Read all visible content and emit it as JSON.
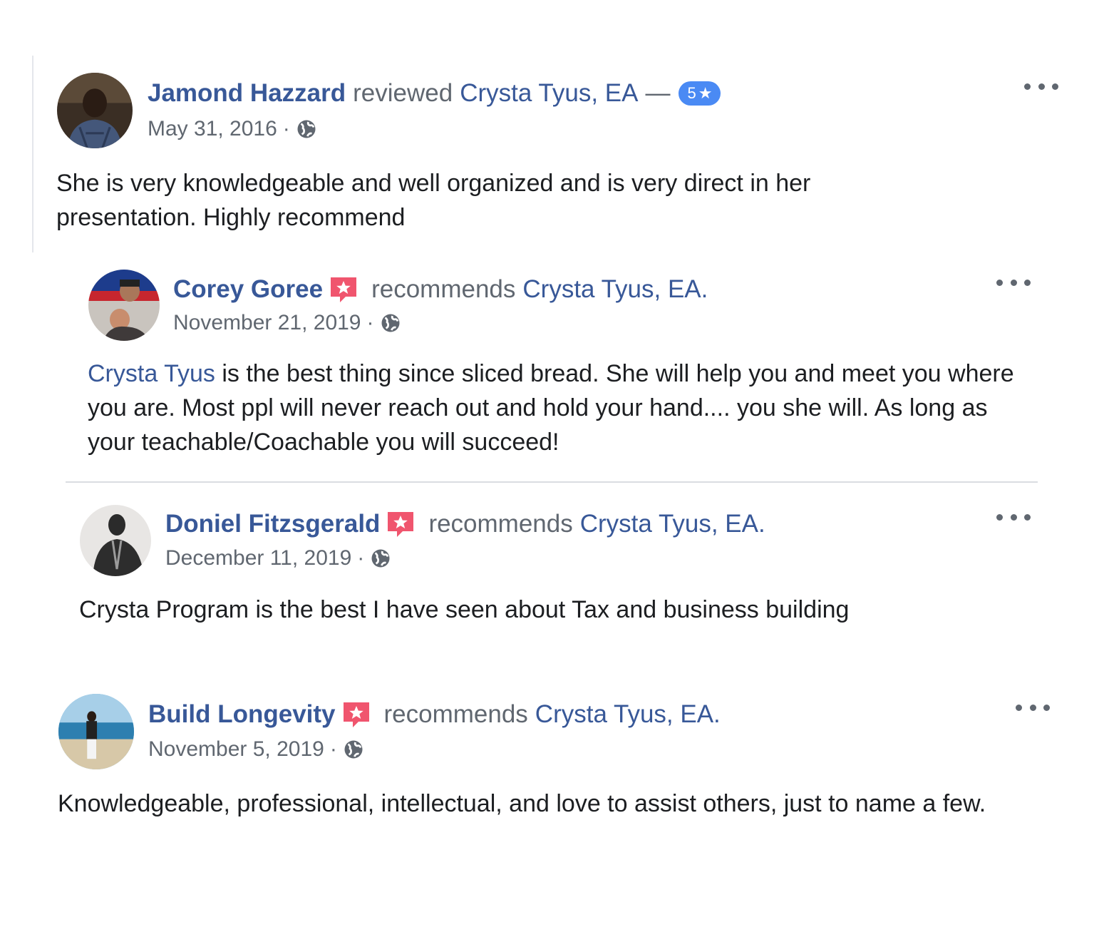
{
  "reviews": [
    {
      "name": "Jamond Hazzard",
      "verb": "reviewed",
      "page": "Crysta Tyus, EA",
      "dash": "—",
      "rating": "5",
      "rating_icon": "star-icon",
      "date": "May 31, 2016",
      "privacy_icon": "globe-icon",
      "body": "She is very knowledgeable and well organized and is very direct in her presentation. Highly recommend"
    },
    {
      "name": "Corey Goree",
      "badge_icon": "recommend-icon",
      "verb": "recommends",
      "page": "Crysta Tyus, EA.",
      "date": "November 21, 2019",
      "privacy_icon": "globe-icon",
      "mention": "Crysta Tyus",
      "body": " is the best thing since sliced bread. She will help you and meet you where you are. Most ppl will never reach out and hold your hand.... you she will. As long as your teachable/Coachable you will succeed!"
    },
    {
      "name": "Doniel Fitzsgerald",
      "badge_icon": "recommend-icon",
      "verb": "recommends",
      "page": "Crysta Tyus, EA.",
      "date": "December 11, 2019",
      "privacy_icon": "globe-icon",
      "body": "Crysta Program is the best I have seen about Tax and business building"
    },
    {
      "name": "Build Longevity",
      "badge_icon": "recommend-icon",
      "verb": "recommends",
      "page": "Crysta Tyus, EA.",
      "date": "November 5, 2019",
      "privacy_icon": "globe-icon",
      "body": "Knowledgeable, professional, intellectual, and love to assist others, just to name a few."
    }
  ],
  "colors": {
    "link": "#385898",
    "muted": "#606770",
    "text": "#1c1e21",
    "rating_badge": "#4a8af4",
    "recommend_badge": "#f0556e"
  },
  "separator": "·"
}
